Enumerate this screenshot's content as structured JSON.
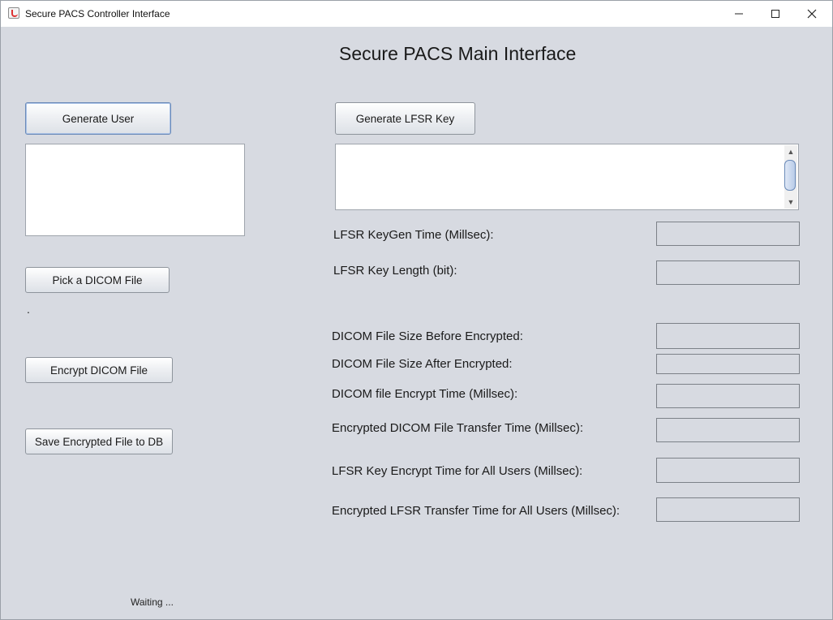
{
  "window": {
    "title": "Secure PACS Controller Interface",
    "controls": {
      "minimize": "minimize-icon",
      "maximize": "maximize-icon",
      "close": "close-icon"
    }
  },
  "main": {
    "heading": "Secure PACS Main Interface"
  },
  "left": {
    "generate_user_label": "Generate User",
    "user_text": "",
    "pick_dicom_label": "Pick a DICOM File",
    "picked_file_text": ".",
    "encrypt_label": "Encrypt DICOM File",
    "save_label": "Save Encrypted File to DB",
    "status_text": "Waiting ..."
  },
  "right": {
    "generate_lfsr_label": "Generate LFSR Key",
    "lfsr_key_text": "",
    "metrics": [
      {
        "label": "LFSR KeyGen Time (Millsec):",
        "value": ""
      },
      {
        "label": "LFSR Key Length (bit):",
        "value": ""
      },
      {
        "label": "DICOM File Size Before Encrypted:",
        "value": ""
      },
      {
        "label": "DICOM File Size After Encrypted:",
        "value": ""
      },
      {
        "label": "DICOM file Encrypt Time (Millsec):",
        "value": ""
      },
      {
        "label": "Encrypted DICOM File Transfer Time (Millsec):",
        "value": ""
      },
      {
        "label": "LFSR Key Encrypt Time for All Users (Millsec):",
        "value": ""
      },
      {
        "label": "Encrypted LFSR Transfer Time for All Users (Millsec):",
        "value": ""
      }
    ]
  },
  "colors": {
    "background": "#d7dae1",
    "focus_border": "#6a8ab8",
    "field_border": "#7c8188"
  }
}
